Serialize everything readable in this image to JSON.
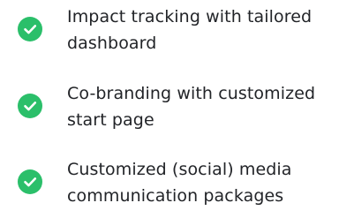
{
  "icon": "check-circle-icon",
  "colors": {
    "accent": "#2bbf6a",
    "text": "#222428"
  },
  "features": [
    {
      "line1": "Impact tracking with tailored",
      "line2": "dashboard"
    },
    {
      "line1": "Co-branding with customized",
      "line2": "start page"
    },
    {
      "line1": "Customized (social) media",
      "line2": "communication packages"
    }
  ]
}
